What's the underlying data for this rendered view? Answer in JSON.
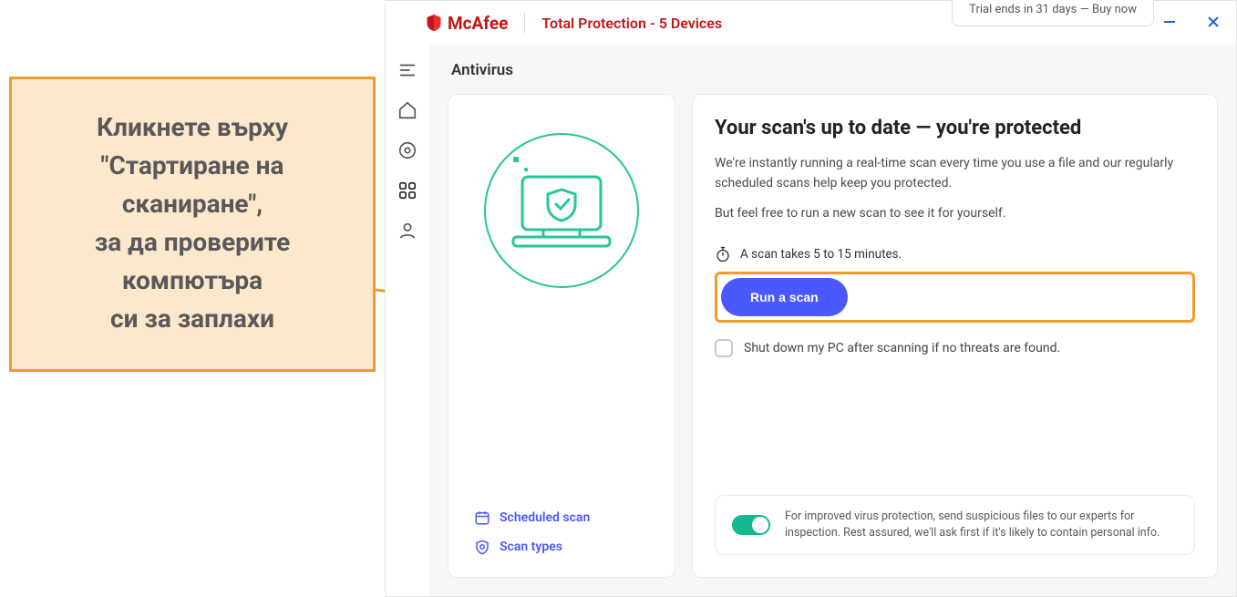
{
  "titlebar": {
    "brand": "McAfee",
    "product": "Total Protection - 5 Devices",
    "trial_notice": "Trial ends in 31 days — Buy now"
  },
  "page": {
    "title": "Antivirus"
  },
  "side_card": {
    "scheduled_scan": "Scheduled scan",
    "scan_types": "Scan types"
  },
  "main": {
    "headline": "Your scan's up to date — you're protected",
    "body1": "We're instantly running a real-time scan every time you use a file and our regularly scheduled scans help keep you protected.",
    "body2": "But feel free to run a new scan to see it for yourself.",
    "scan_time": "A scan takes 5 to 15 minutes.",
    "run_scan": "Run a scan",
    "shutdown_label": "Shut down my PC after scanning if no threats are found."
  },
  "footer": {
    "text": "For improved virus protection, send suspicious files to our experts for inspection. Rest assured, we'll ask first if it's likely to contain personal info."
  },
  "callout": {
    "line1": "Кликнете върху",
    "line2": "\"Стартиране на",
    "line3": "сканиране\",",
    "line4": "за да проверите",
    "line5": "компютъра",
    "line6": "си за заплахи"
  },
  "colors": {
    "accent_red": "#c01818",
    "accent_blue": "#4a58ff",
    "accent_green": "#29c598",
    "callout_orange": "#ec9b2d"
  }
}
